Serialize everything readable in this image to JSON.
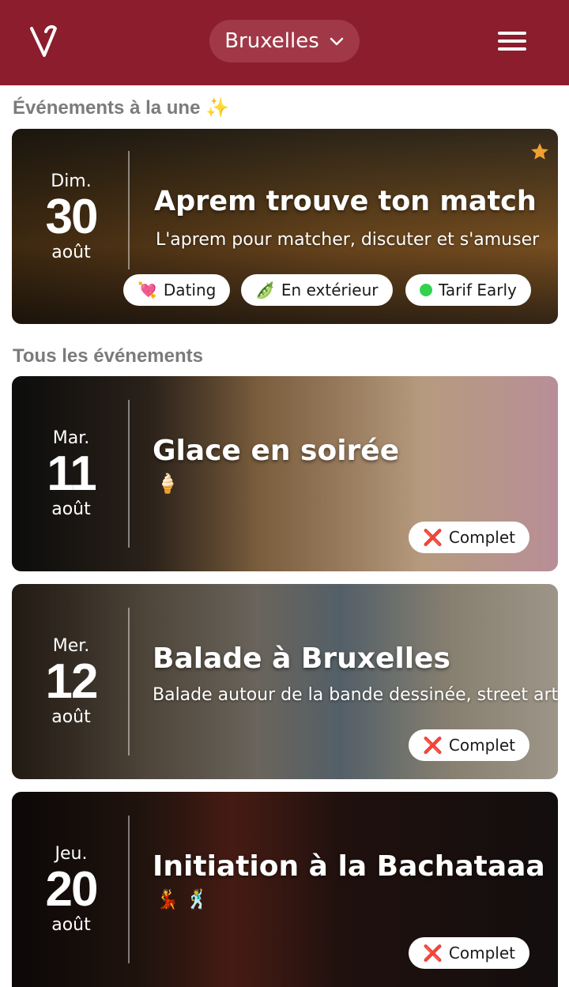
{
  "header": {
    "city": "Bruxelles"
  },
  "sections": {
    "featured": "Événements à la une ✨",
    "all": "Tous les événements"
  },
  "featured_event": {
    "day": "Dim.",
    "date": "30",
    "month": "août",
    "title": "Aprem trouve ton match",
    "subtitle": "L'aprem pour matcher, discuter et s'amuser",
    "tags": [
      {
        "icon": "💘",
        "label": "Dating"
      },
      {
        "icon": "🫛",
        "label": "En extérieur"
      },
      {
        "icon": "green-dot",
        "label": "Tarif Early"
      }
    ]
  },
  "events": [
    {
      "day": "Mar.",
      "date": "11",
      "month": "août",
      "title": "Glace en soirée",
      "extra": "🍦",
      "status_icon": "❌",
      "status": "Complet"
    },
    {
      "day": "Mer.",
      "date": "12",
      "month": "août",
      "title": "Balade à Bruxelles",
      "extra": "Balade autour de la bande dessinée, street art",
      "status_icon": "❌",
      "status": "Complet"
    },
    {
      "day": "Jeu.",
      "date": "20",
      "month": "août",
      "title": "Initiation à la Bachataaa",
      "extra": "💃 🕺",
      "status_icon": "❌",
      "status": "Complet"
    }
  ],
  "colors": {
    "brand": "#8b1d2c",
    "accent_star": "#f0a030",
    "tag_dot": "#33d24e"
  }
}
